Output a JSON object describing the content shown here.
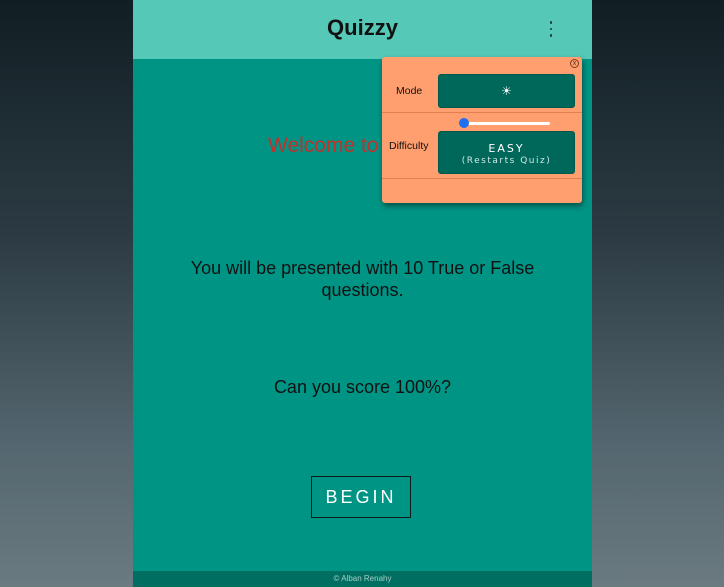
{
  "app": {
    "title": "Quizzy"
  },
  "main": {
    "welcome": "Welcome to",
    "intro": "You will be presented with 10 True or False questions.",
    "challenge": "Can you score 100%?",
    "begin_label": "BEGIN"
  },
  "footer": {
    "credit": "© Alban Renahy"
  },
  "settings": {
    "close_glyph": "x",
    "mode_label": "Mode",
    "mode_icon": "sun-icon",
    "mode_glyph": "☀",
    "difficulty_label": "Difficulty",
    "difficulty_level": 0,
    "difficulty_value": "EASY",
    "difficulty_note": "(Restarts Quiz)"
  },
  "colors": {
    "header": "#56c8b7",
    "background": "#009485",
    "panel": "#ff9e6e",
    "button": "#00685b",
    "welcome_text": "#c0322b",
    "slider_accent": "#1f6ff0"
  }
}
